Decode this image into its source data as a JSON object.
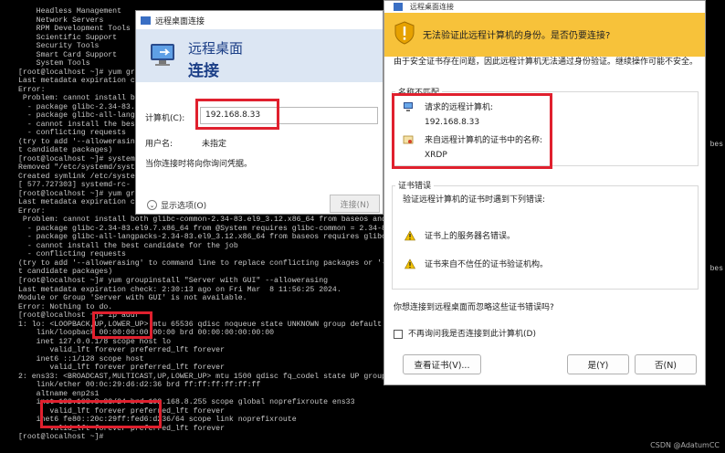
{
  "terminal": {
    "lines": [
      "    Headless Management",
      "    Network Servers",
      "    RPM Development Tools",
      "    Scientific Support",
      "    Security Tools",
      "    Smart Card Support",
      "    System Tools",
      "[root@localhost ~]# yum group",
      "Last metadata expiration c",
      "Error:",
      " Problem: cannot install b",
      "  - package glibc-2.34-83.",
      "  - package glibc-all-lang",
      "  - cannot install the bes",
      "  - conflicting requests",
      "(try to add '--allowerasing",
      "t candidate packages)",
      "[root@localhost ~]# system",
      "Removed \"/etc/systemd/syste",
      "Created symlink /etc/system",
      "[ 577.727303] systemd-rc-",
      "[root@localhost ~]# yum gr",
      "Last metadata expiration c",
      "Error:",
      " Problem: cannot install both glibc-common-2.34-83.el9_3.12.x86_64 from baseos and",
      "  - package glibc-2.34-83.el9.7.x86_64 from @System requires glibc-common = 2.34-83",
      "  - package glibc-all-langpacks-2.34-83.el9_3.12.x86_64 from baseos requires glibc-",
      "  - cannot install the best candidate for the job",
      "  - conflicting requests",
      "(try to add '--allowerasing' to command line to replace conflicting packages or '--",
      "t candidate packages)",
      "[root@localhost ~]# yum groupinstall \"Server with GUI\" --allowerasing",
      "Last metadata expiration check: 2:30:13 ago on Fri Mar  8 11:56:25 2024.",
      "Module or Group 'Server with GUI' is not available.",
      "Error: Nothing to do.",
      "[root@localhost ~]# ip addr",
      "1: lo: <LOOPBACK,UP,LOWER_UP> mtu 65536 qdisc noqueue state UNKNOWN group default q",
      "    link/loopback 00:00:00:00:00:00 brd 00:00:00:00:00:00",
      "    inet 127.0.0.1/8 scope host lo",
      "       valid_lft forever preferred_lft forever",
      "    inet6 ::1/128 scope host",
      "       valid_lft forever preferred_lft forever",
      "2: ens33: <BROADCAST,MULTICAST,UP,LOWER_UP> mtu 1500 qdisc fq_codel state UP group default qlen 1000",
      "    link/ether 00:0c:29:d6:d2:36 brd ff:ff:ff:ff:ff:ff",
      "    altname enp2s1",
      "    inet 192.168.8.33/24 brd 192.168.8.255 scope global noprefixroute ens33",
      "       valid_lft forever preferred_lft forever",
      "    inet6 fe80::20c:29ff:fed6:d236/64 scope link noprefixroute",
      "       valid_lft forever preferred_lft forever",
      "[root@localhost ~]#"
    ],
    "side_labels": [
      "bes",
      "bes"
    ]
  },
  "dialog1": {
    "title": "远程桌面连接",
    "banner_line1": "远程桌面",
    "banner_line2": "连接",
    "computer_label": "计算机(C):",
    "computer_value": "192.168.8.33",
    "username_label": "用户名:",
    "username_value": "未指定",
    "note": "当你连接时将向你询问凭据。",
    "show_options": "显示选项(O)",
    "connect_button": "连接(N)"
  },
  "dialog2": {
    "title": "远程桌面连接",
    "warning_header": "无法验证此远程计算机的身份。是否仍要连接?",
    "intro": "由于安全证书存在问题，因此远程计算机无法通过身份验证。继续操作可能不安全。",
    "name_mismatch_title": "名称不匹配",
    "requested_label": "请求的远程计算机:",
    "requested_value": "192.168.8.33",
    "cert_name_label": "来自远程计算机的证书中的名称:",
    "cert_name_value": "XRDP",
    "cert_errors_title": "证书错误",
    "cert_errors_intro": "验证远程计算机的证书时遇到下列错误:",
    "error1": "证书上的服务器名错误。",
    "error2": "证书来自不信任的证书验证机构。",
    "question": "你想连接到远程桌面而忽略这些证书错误吗?",
    "checkbox_label": "不再询问我是否连接到此计算机(D)",
    "view_cert_button": "查看证书(V)...",
    "yes_button": "是(Y)",
    "no_button": "否(N)"
  },
  "watermark": "CSDN @AdatumCC",
  "colors": {
    "highlight_red": "#e0202e",
    "warning_yellow": "#f7c23a",
    "banner_blue": "#dce6f3",
    "title_blue": "#1c3f87"
  },
  "icons": [
    "rdp-computer-icon",
    "warning-shield-icon",
    "computer-icon",
    "certificate-icon",
    "warning-triangle-icon",
    "info-icon"
  ]
}
